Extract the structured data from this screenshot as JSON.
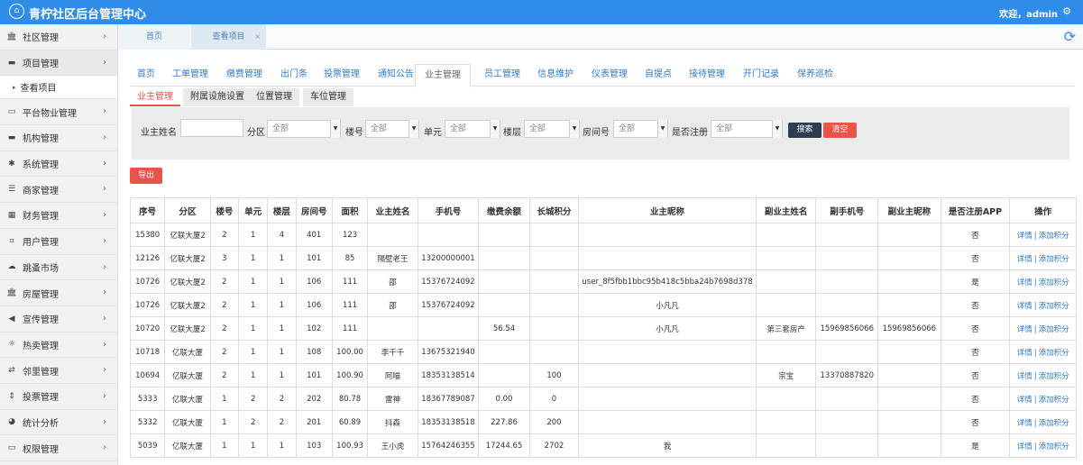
{
  "app": {
    "title": "青柠社区后台管理中心",
    "welcome": "欢迎，admin",
    "logo_char": "⌂"
  },
  "sidebar": {
    "items": [
      {
        "label": "社区管理",
        "icon": "building-icon"
      },
      {
        "label": "项目管理",
        "icon": "project-icon"
      },
      {
        "label": "平台物业管理",
        "icon": "monitor-icon"
      },
      {
        "label": "机构管理",
        "icon": "stripe-icon"
      },
      {
        "label": "系统管理",
        "icon": "yelp-icon"
      },
      {
        "label": "商家管理",
        "icon": "list-icon"
      },
      {
        "label": "财务管理",
        "icon": "calculator-icon"
      },
      {
        "label": "用户管理",
        "icon": "crop-icon"
      },
      {
        "label": "跳蚤市场",
        "icon": "cloud-icon"
      },
      {
        "label": "房屋管理",
        "icon": "bank-icon"
      },
      {
        "label": "宣传管理",
        "icon": "volume-icon"
      },
      {
        "label": "热卖管理",
        "icon": "sun-icon"
      },
      {
        "label": "邻里管理",
        "icon": "retweet-icon"
      },
      {
        "label": "投票管理",
        "icon": "sort-icon"
      },
      {
        "label": "统计分析",
        "icon": "piechart-icon"
      },
      {
        "label": "权限管理",
        "icon": "desktop-icon"
      }
    ],
    "subitem": "查看项目"
  },
  "pagetabs": {
    "home": "首页",
    "current": "查看项目",
    "close": "×"
  },
  "navtabs": [
    "首页",
    "工单管理",
    "缴费管理",
    "出门条",
    "投票管理",
    "通知公告",
    "业主管理",
    "员工管理",
    "信息维护",
    "仪表管理",
    "自提点",
    "接待管理",
    "开门记录",
    "保养巡检"
  ],
  "subtabs": [
    "业主管理",
    "附属设施设置",
    "位置管理",
    "车位管理"
  ],
  "filters": {
    "owner_name": "业主姓名",
    "district": "分区",
    "building": "楼号",
    "unit": "单元",
    "floor": "楼层",
    "room": "房间号",
    "registered": "是否注册",
    "all": "全部",
    "search": "搜索",
    "clear": "清空"
  },
  "export": "导出",
  "table": {
    "headers": [
      "序号",
      "分区",
      "楼号",
      "单元",
      "楼层",
      "房间号",
      "面积",
      "业主姓名",
      "手机号",
      "缴费余额",
      "长城积分",
      "业主昵称",
      "副业主姓名",
      "副手机号",
      "副业主昵称",
      "是否注册APP",
      "操作"
    ],
    "action_detail": "详情",
    "action_points": "添加积分",
    "rows": [
      [
        "15380",
        "亿联大厦2",
        "2",
        "1",
        "4",
        "401",
        "123",
        "",
        "",
        "",
        "",
        "",
        "",
        "",
        "",
        "否"
      ],
      [
        "12126",
        "亿联大厦2",
        "3",
        "1",
        "1",
        "101",
        "85",
        "隔壁老王",
        "13200000001",
        "",
        "",
        "",
        "",
        "",
        "",
        "否"
      ],
      [
        "10726",
        "亿联大厦2",
        "2",
        "1",
        "1",
        "106",
        "111",
        "邵",
        "15376724092",
        "",
        "",
        "user_8f5fbb1bbc95b418c5bba24b7698d378",
        "",
        "",
        "",
        "是"
      ],
      [
        "10726",
        "亿联大厦2",
        "2",
        "1",
        "1",
        "106",
        "111",
        "邵",
        "15376724092",
        "",
        "",
        "小凡凡",
        "",
        "",
        "",
        "否"
      ],
      [
        "10720",
        "亿联大厦2",
        "2",
        "1",
        "1",
        "102",
        "111",
        "",
        "",
        "56.54",
        "",
        "小凡凡",
        "第三套房产",
        "15969856066",
        "15969856066",
        "否"
      ],
      [
        "10718",
        "亿联大厦",
        "2",
        "1",
        "1",
        "108",
        "100.00",
        "李千千",
        "13675321940",
        "",
        "",
        "",
        "",
        "",
        "",
        "否"
      ],
      [
        "10694",
        "亿联大厦",
        "2",
        "1",
        "1",
        "101",
        "100.90",
        "阿喵",
        "18353138514",
        "",
        "100",
        "",
        "宗宝",
        "13370887820",
        "",
        "否"
      ],
      [
        "5333",
        "亿联大厦",
        "1",
        "2",
        "2",
        "202",
        "80.78",
        "雷神",
        "18367789087",
        "0.00",
        "0",
        "",
        "",
        "",
        "",
        "否"
      ],
      [
        "5332",
        "亿联大厦",
        "1",
        "2",
        "2",
        "201",
        "60.89",
        "抖森",
        "18353138518",
        "227.86",
        "200",
        "",
        "",
        "",
        "",
        "否"
      ],
      [
        "5039",
        "亿联大厦",
        "1",
        "1",
        "1",
        "103",
        "100.93",
        "王小虎",
        "15764246355",
        "17244.65",
        "2702",
        "我",
        "",
        "",
        "",
        "是"
      ]
    ]
  }
}
